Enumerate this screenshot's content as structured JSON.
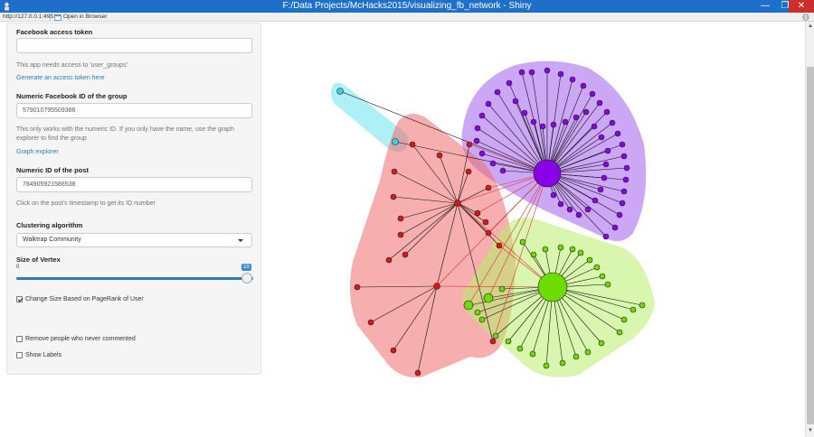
{
  "window": {
    "title": "F:/Data Projects/McHacks2015/visualizing_fb_network - Shiny",
    "minimize_label": "—",
    "maximize_label": "❐",
    "close_label": "✕"
  },
  "address_bar": {
    "url": "http://127.0.0.1:4951",
    "open_in_browser": "Open in Browser"
  },
  "sidebar": {
    "token": {
      "label": "Facebook access token",
      "value": "",
      "help": "This app needs access to 'user_groups'",
      "link": "Generate an access token here"
    },
    "group": {
      "label": "Numeric Facebook ID of the group",
      "value": "579010795509386",
      "help": "This only works with the numeric ID. If you only have the name, use the graph explorer to find the group",
      "link": "Graph explorer"
    },
    "post": {
      "label": "Numeric ID of the post",
      "value": "784905921586538",
      "help": "Click on the post's timestamp to get its ID number"
    },
    "clustering": {
      "label": "Clustering algorithm",
      "selected": "Walktrap Community"
    },
    "vertex_size": {
      "label": "Size of Vertex",
      "min": "0",
      "max": "10",
      "value": 10
    },
    "checkboxes": {
      "pagerank": {
        "label": "Change Size Based on PageRank of User",
        "checked": true
      },
      "remove": {
        "label": "Remove people who never commented",
        "checked": false
      },
      "labels": {
        "label": "Show Labels",
        "checked": false
      }
    }
  },
  "colors": {
    "title_bar": "#1e6fc9",
    "link": "#337ab7",
    "cluster_red": "#ef6b6b",
    "cluster_purple": "#a35fef",
    "cluster_green": "#b8ef6b",
    "cluster_cyan": "#6be3ef",
    "node_red": "#e01414",
    "node_purple": "#8a00e6",
    "node_green": "#6ddc00",
    "node_cyan": "#3ecfe0"
  }
}
